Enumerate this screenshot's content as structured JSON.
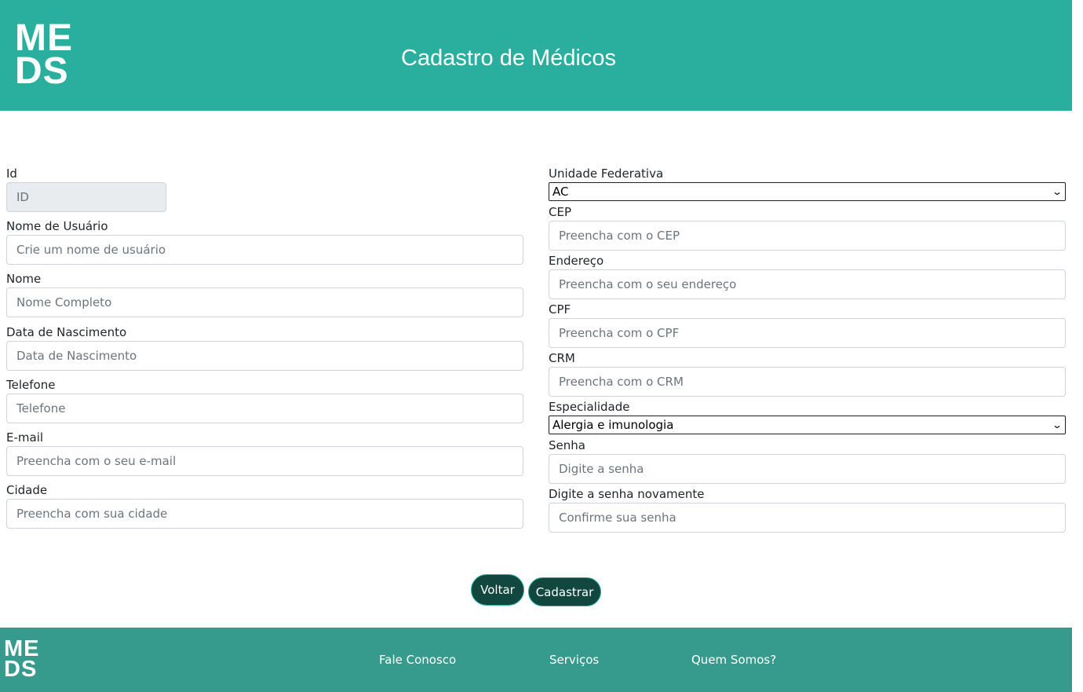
{
  "header": {
    "logo_line1": "ME",
    "logo_line2": "DS",
    "title": "Cadastro de Médicos"
  },
  "form_left": {
    "id": {
      "label": "Id",
      "placeholder": "ID"
    },
    "username": {
      "label": "Nome de Usuário",
      "placeholder": "Crie um nome de usuário"
    },
    "name": {
      "label": "Nome",
      "placeholder": "Nome Completo"
    },
    "birthdate": {
      "label": "Data de Nascimento",
      "placeholder": "Data de Nascimento"
    },
    "phone": {
      "label": "Telefone",
      "placeholder": "Telefone"
    },
    "email": {
      "label": "E-mail",
      "placeholder": "Preencha com o seu e-mail"
    },
    "city": {
      "label": "Cidade",
      "placeholder": "Preencha com sua cidade"
    }
  },
  "form_right": {
    "uf": {
      "label": "Unidade Federativa",
      "selected": "AC"
    },
    "cep": {
      "label": "CEP",
      "placeholder": "Preencha com o CEP"
    },
    "address": {
      "label": "Endereço",
      "placeholder": "Preencha com o seu endereço"
    },
    "cpf": {
      "label": "CPF",
      "placeholder": "Preencha com o CPF"
    },
    "crm": {
      "label": "CRM",
      "placeholder": "Preencha com o CRM"
    },
    "specialty": {
      "label": "Especialidade",
      "selected": "Alergia e imunologia"
    },
    "password": {
      "label": "Senha",
      "placeholder": "Digite a senha"
    },
    "password_confirm": {
      "label": "Digite a senha novamente",
      "placeholder": "Confirme sua senha"
    }
  },
  "buttons": {
    "back": "Voltar",
    "submit": "Cadastrar"
  },
  "footer": {
    "logo_line1": "ME",
    "logo_line2": "DS",
    "links": [
      "Fale Conosco",
      "Serviços",
      "Quem Somos?"
    ]
  },
  "colors": {
    "header_bg": "#2aae9e",
    "footer_bg": "#369a8c",
    "button_bg": "#11473f"
  },
  "icons": {
    "select_arrow": "chevron-down-icon"
  }
}
